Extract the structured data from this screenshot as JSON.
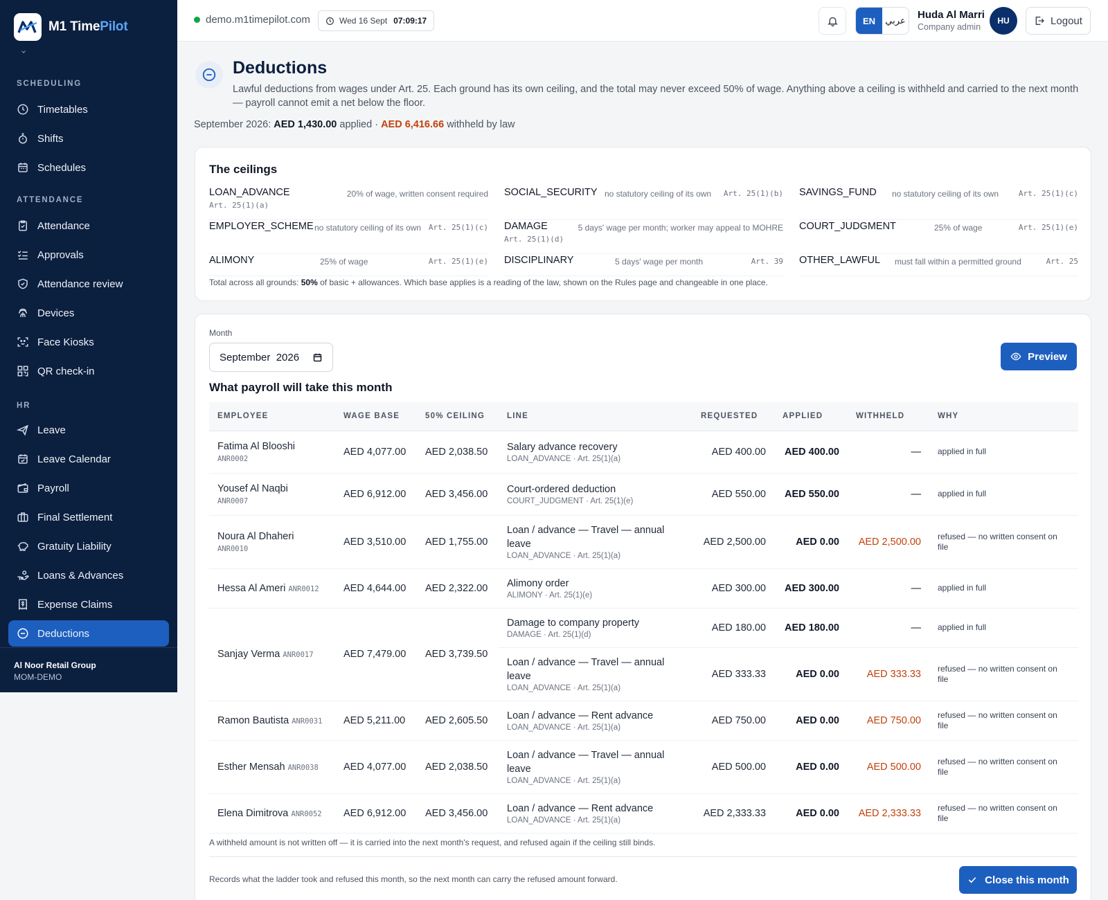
{
  "brand": {
    "name_main": "M1 Time",
    "name_accent": "Pilot"
  },
  "sidebar": {
    "sections": [
      "SCHEDULING",
      "ATTENDANCE",
      "HR"
    ],
    "items": [
      {
        "label": "Timetables",
        "icon": "clock-icon"
      },
      {
        "label": "Shifts",
        "icon": "stopwatch-icon"
      },
      {
        "label": "Schedules",
        "icon": "calendar-icon"
      },
      {
        "label": "Attendance",
        "icon": "clipboard-check-icon"
      },
      {
        "label": "Approvals",
        "icon": "list-check-icon"
      },
      {
        "label": "Attendance review",
        "icon": "shield-check-icon"
      },
      {
        "label": "Devices",
        "icon": "fingerprint-icon"
      },
      {
        "label": "Face Kiosks",
        "icon": "face-scan-icon"
      },
      {
        "label": "QR check-in",
        "icon": "qr-code-icon"
      },
      {
        "label": "Leave",
        "icon": "plane-icon"
      },
      {
        "label": "Leave Calendar",
        "icon": "calendar-check-icon"
      },
      {
        "label": "Payroll",
        "icon": "wallet-icon"
      },
      {
        "label": "Final Settlement",
        "icon": "briefcase-icon"
      },
      {
        "label": "Gratuity Liability",
        "icon": "piggy-bank-icon"
      },
      {
        "label": "Loans & Advances",
        "icon": "hand-coins-icon"
      },
      {
        "label": "Expense Claims",
        "icon": "receipt-icon"
      },
      {
        "label": "Deductions",
        "icon": "minus-circle-icon",
        "active": true
      }
    ],
    "org_name": "Al Noor Retail Group",
    "org_code": "MOM-DEMO"
  },
  "topbar": {
    "host": "demo.m1timepilot.com",
    "date": "Wed 16 Sept",
    "time": "07:09:17",
    "lang_en": "EN",
    "lang_ar": "عربي",
    "user_name": "Huda Al Marri",
    "user_role": "Company admin",
    "avatar": "HU",
    "logout": "Logout"
  },
  "page": {
    "title": "Deductions",
    "description": "Lawful deductions from wages under Art. 25. Each ground has its own ceiling, and the total may never exceed 50% of wage. Anything above a ceiling is withheld and carried to the next month — payroll cannot emit a net below the floor.",
    "summary_month": "September 2026:",
    "summary_applied": "AED 1,430.00",
    "summary_applied_label": "applied ·",
    "summary_withheld": "AED 6,416.66",
    "summary_withheld_label": "withheld by law"
  },
  "ceilings": {
    "title": "The ceilings",
    "items": [
      {
        "code": "LOAN_ADVANCE",
        "rule": "20% of wage, written consent required",
        "art": "Art. 25(1)(a)"
      },
      {
        "code": "SOCIAL_SECURITY",
        "rule": "no statutory ceiling of its own",
        "art": "Art. 25(1)(b)"
      },
      {
        "code": "SAVINGS_FUND",
        "rule": "no statutory ceiling of its own",
        "art": "Art. 25(1)(c)"
      },
      {
        "code": "EMPLOYER_SCHEME",
        "rule": "no statutory ceiling of its own",
        "art": "Art. 25(1)(c)"
      },
      {
        "code": "DAMAGE",
        "rule": "5 days' wage per month; worker may appeal to MOHRE",
        "art": "Art. 25(1)(d)"
      },
      {
        "code": "COURT_JUDGMENT",
        "rule": "25% of wage",
        "art": "Art. 25(1)(e)"
      },
      {
        "code": "ALIMONY",
        "rule": "25% of wage",
        "art": "Art. 25(1)(e)"
      },
      {
        "code": "DISCIPLINARY",
        "rule": "5 days' wage per month",
        "art": "Art. 39"
      },
      {
        "code": "OTHER_LAWFUL",
        "rule": "must fall within a permitted ground",
        "art": "Art. 25"
      }
    ],
    "note_prefix": "Total across all grounds:",
    "note_bold": "50%",
    "note_suffix": "of basic + allowances. Which base applies is a reading of the law, shown on the Rules page and changeable in one place."
  },
  "ladder": {
    "month_label": "Month",
    "month_value": "September  2026",
    "preview_label": "Preview",
    "section_title": "What payroll will take this month",
    "columns": [
      "EMPLOYEE",
      "WAGE BASE",
      "50% CEILING",
      "LINE",
      "REQUESTED",
      "APPLIED",
      "WITHHELD",
      "WHY"
    ],
    "rows": [
      {
        "name": "Fatima Al Blooshi",
        "id": "ANR0002",
        "wage": "AED 4,077.00",
        "ceiling": "AED 2,038.50",
        "line": "Salary advance recovery",
        "ground": "LOAN_ADVANCE · Art. 25(1)(a)",
        "requested": "AED 400.00",
        "applied": "AED 400.00",
        "withheld": "—",
        "why": "applied in full"
      },
      {
        "name": "Yousef Al Naqbi",
        "id": "ANR0007",
        "wage": "AED 6,912.00",
        "ceiling": "AED 3,456.00",
        "line": "Court-ordered deduction",
        "ground": "COURT_JUDGMENT · Art. 25(1)(e)",
        "requested": "AED 550.00",
        "applied": "AED 550.00",
        "withheld": "—",
        "why": "applied in full"
      },
      {
        "name": "Noura Al Dhaheri",
        "id": "ANR0010",
        "wage": "AED 3,510.00",
        "ceiling": "AED 1,755.00",
        "line": "Loan / advance — Travel — annual leave",
        "ground": "LOAN_ADVANCE · Art. 25(1)(a)",
        "requested": "AED 2,500.00",
        "applied": "AED 0.00",
        "withheld": "AED 2,500.00",
        "why": "refused — no written consent on file"
      },
      {
        "name": "Hessa Al Ameri",
        "id": "ANR0012",
        "wage": "AED 4,644.00",
        "ceiling": "AED 2,322.00",
        "line": "Alimony order",
        "ground": "ALIMONY · Art. 25(1)(e)",
        "requested": "AED 300.00",
        "applied": "AED 300.00",
        "withheld": "—",
        "why": "applied in full"
      },
      {
        "name": "Sanjay Verma",
        "id": "ANR0017",
        "wage": "AED 7,479.00",
        "ceiling": "AED 3,739.50",
        "line": "Damage to company property",
        "ground": "DAMAGE · Art. 25(1)(d)",
        "requested": "AED 180.00",
        "applied": "AED 180.00",
        "withheld": "—",
        "why": "applied in full"
      },
      {
        "line": "Loan / advance — Travel — annual leave",
        "ground": "LOAN_ADVANCE · Art. 25(1)(a)",
        "requested": "AED 333.33",
        "applied": "AED 0.00",
        "withheld": "AED 333.33",
        "why": "refused — no written consent on file"
      },
      {
        "name": "Ramon Bautista",
        "id": "ANR0031",
        "wage": "AED 5,211.00",
        "ceiling": "AED 2,605.50",
        "line": "Loan / advance — Rent advance",
        "ground": "LOAN_ADVANCE · Art. 25(1)(a)",
        "requested": "AED 750.00",
        "applied": "AED 0.00",
        "withheld": "AED 750.00",
        "why": "refused — no written consent on file"
      },
      {
        "name": "Esther Mensah",
        "id": "ANR0038",
        "wage": "AED 4,077.00",
        "ceiling": "AED 2,038.50",
        "line": "Loan / advance — Travel — annual leave",
        "ground": "LOAN_ADVANCE · Art. 25(1)(a)",
        "requested": "AED 500.00",
        "applied": "AED 0.00",
        "withheld": "AED 500.00",
        "why": "refused — no written consent on file"
      },
      {
        "name": "Elena Dimitrova",
        "id": "ANR0052",
        "wage": "AED 6,912.00",
        "ceiling": "AED 3,456.00",
        "line": "Loan / advance — Rent advance",
        "ground": "LOAN_ADVANCE · Art. 25(1)(a)",
        "requested": "AED 2,333.33",
        "applied": "AED 0.00",
        "withheld": "AED 2,333.33",
        "why": "refused — no written consent on file"
      }
    ],
    "withheld_note": "A withheld amount is not written off — it is carried into the next month's request, and refused again if the ceiling still binds.",
    "close_note": "Records what the ladder took and refused this month, so the next month can carry the refused amount forward.",
    "close_label": "Close this month"
  },
  "colors": {
    "navy": "#0b1f3f",
    "accent": "#1d5fbf",
    "withheld": "#c2410c",
    "online": "#16a34a"
  }
}
